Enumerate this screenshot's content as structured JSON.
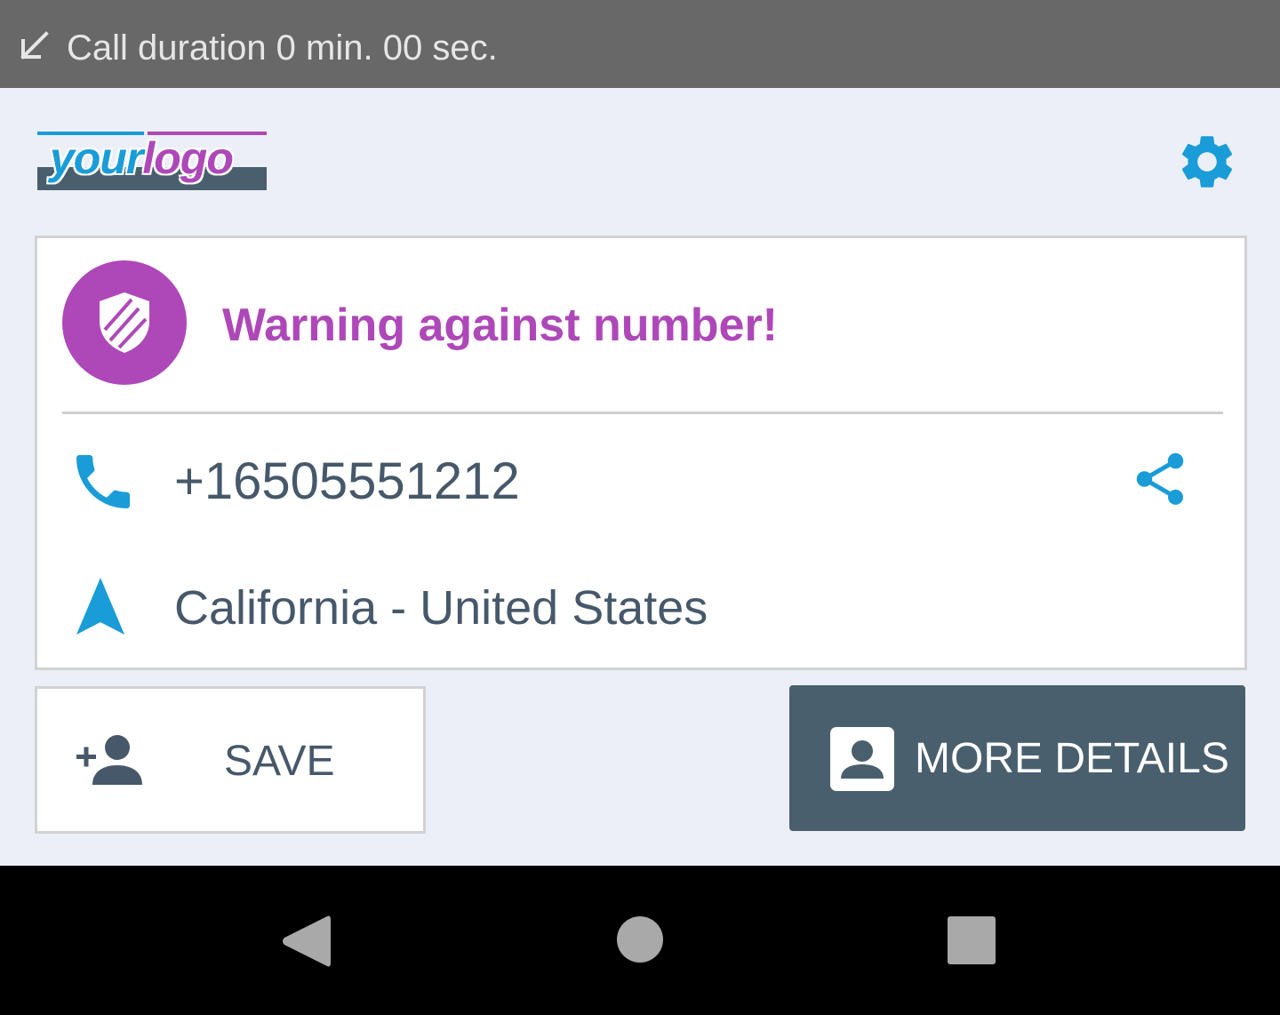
{
  "status_bar": {
    "call_duration_text": "Call duration 0 min. 00 sec.",
    "icon": "incoming-call-arrow-icon"
  },
  "header": {
    "logo_part1": "your",
    "logo_part2": "logo",
    "settings_icon": "gear-icon"
  },
  "card": {
    "warning_title": "Warning against number!",
    "warning_icon": "shield-icon",
    "phone_number": "+16505551212",
    "phone_icon": "phone-icon",
    "share_icon": "share-icon",
    "location": "California - United States",
    "location_icon": "navigation-icon"
  },
  "actions": {
    "save_label": "SAVE",
    "save_icon": "add-person-icon",
    "details_label": "MORE DETAILS",
    "details_icon": "contact-card-icon"
  },
  "system_nav": {
    "back_icon": "back-triangle-icon",
    "home_icon": "home-circle-icon",
    "recents_icon": "recents-square-icon"
  },
  "colors": {
    "accent_blue": "#1A9CD8",
    "warning_purple": "#AE48B8",
    "slate": "#4A5F6E",
    "background": "#ECEFF7"
  }
}
